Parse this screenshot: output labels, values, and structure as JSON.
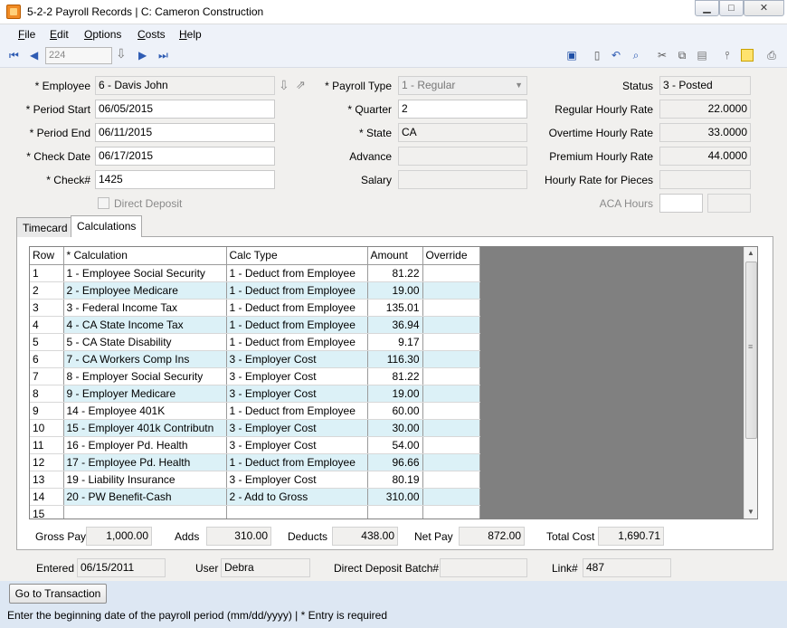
{
  "window": {
    "title": "5-2-2 Payroll Records  |  C: Cameron Construction",
    "min_glyph": "▁",
    "max_glyph": "□",
    "close_glyph": "✕"
  },
  "menu": [
    "File",
    "Edit",
    "Options",
    "Costs",
    "Help"
  ],
  "toolbar": {
    "record": "224"
  },
  "form": {
    "employee_label": "* Employee",
    "employee": "6 - Davis John",
    "period_start_label": "* Period Start",
    "period_start": "06/05/2015",
    "period_end_label": "* Period End",
    "period_end": "06/11/2015",
    "check_date_label": "* Check Date",
    "check_date": "06/17/2015",
    "check_no_label": "* Check#",
    "check_no": "1425",
    "direct_deposit_label": "Direct Deposit",
    "payroll_type_label": "* Payroll Type",
    "payroll_type": "1 - Regular",
    "quarter_label": "* Quarter",
    "quarter": "2",
    "state_label": "* State",
    "state": "CA",
    "advance_label": "Advance",
    "advance": "",
    "salary_label": "Salary",
    "salary": "",
    "status_label": "Status",
    "status": "3 - Posted",
    "regular_rate_label": "Regular Hourly Rate",
    "regular_rate": "22.0000",
    "overtime_rate_label": "Overtime Hourly Rate",
    "overtime_rate": "33.0000",
    "premium_rate_label": "Premium Hourly Rate",
    "premium_rate": "44.0000",
    "pieces_rate_label": "Hourly Rate for Pieces",
    "pieces_rate": "",
    "aca_hours_label": "ACA Hours",
    "aca_hours": ""
  },
  "tabs": [
    "Timecard",
    "Calculations"
  ],
  "grid": {
    "headers": [
      "Row",
      "* Calculation",
      "Calc Type",
      "Amount",
      "Override"
    ],
    "rows": [
      [
        "1",
        "1 - Employee Social Security",
        "1 - Deduct from Employee",
        "81.22",
        ""
      ],
      [
        "2",
        "2 - Employee Medicare",
        "1 - Deduct from Employee",
        "19.00",
        ""
      ],
      [
        "3",
        "3 - Federal Income Tax",
        "1 - Deduct from Employee",
        "135.01",
        ""
      ],
      [
        "4",
        "4 - CA State Income Tax",
        "1 - Deduct from Employee",
        "36.94",
        ""
      ],
      [
        "5",
        "5 - CA State Disability",
        "1 - Deduct from Employee",
        "9.17",
        ""
      ],
      [
        "6",
        "7 - CA Workers Comp Ins",
        "3 - Employer Cost",
        "116.30",
        ""
      ],
      [
        "7",
        "8 - Employer Social Security",
        "3 - Employer Cost",
        "81.22",
        ""
      ],
      [
        "8",
        "9 - Employer Medicare",
        "3 - Employer Cost",
        "19.00",
        ""
      ],
      [
        "9",
        "14 - Employee 401K",
        "1 - Deduct from Employee",
        "60.00",
        ""
      ],
      [
        "10",
        "15 - Employer 401k Contributn",
        "3 - Employer Cost",
        "30.00",
        ""
      ],
      [
        "11",
        "16 - Employer Pd. Health",
        "3 - Employer Cost",
        "54.00",
        ""
      ],
      [
        "12",
        "17 - Employee Pd. Health",
        "1 - Deduct from Employee",
        "96.66",
        ""
      ],
      [
        "13",
        "19 - Liability Insurance",
        "3 - Employer Cost",
        "80.19",
        ""
      ],
      [
        "14",
        "20 - PW Benefit-Cash",
        "2 - Add to Gross",
        "310.00",
        ""
      ],
      [
        "15",
        "",
        "",
        "",
        ""
      ]
    ]
  },
  "totals": {
    "gross_pay_label": "Gross Pay",
    "gross_pay": "1,000.00",
    "adds_label": "Adds",
    "adds": "310.00",
    "deducts_label": "Deducts",
    "deducts": "438.00",
    "net_pay_label": "Net Pay",
    "net_pay": "872.00",
    "total_cost_label": "Total Cost",
    "total_cost": "1,690.71"
  },
  "audit": {
    "entered_label": "Entered",
    "entered": "06/15/2011",
    "user_label": "User",
    "user": "Debra",
    "dd_batch_label": "Direct Deposit Batch#",
    "dd_batch": "",
    "link_label": "Link#",
    "link": "487"
  },
  "footer": {
    "go_button": "Go to Transaction",
    "status": "Enter the beginning date of the payroll period (mm/dd/yyyy)  |  * Entry is required"
  }
}
